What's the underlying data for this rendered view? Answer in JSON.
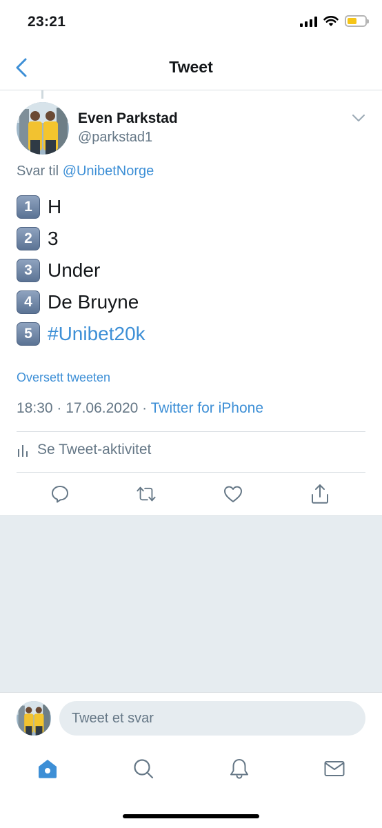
{
  "status_bar": {
    "time": "23:21"
  },
  "nav": {
    "title": "Tweet"
  },
  "tweet": {
    "author_name": "Even Parkstad",
    "author_handle": "@parkstad1",
    "reply_prefix": "Svar til",
    "reply_to": "@UnibetNorge",
    "lines": [
      {
        "key": "1",
        "text": "H"
      },
      {
        "key": "2",
        "text": "3"
      },
      {
        "key": "3",
        "text": "Under"
      },
      {
        "key": "4",
        "text": "De Bruyne"
      },
      {
        "key": "5",
        "text": "#Unibet20k"
      }
    ],
    "translate_label": "Oversett tweeten",
    "timestamp": "18:30 · 17.06.2020 · ",
    "source": "Twitter for iPhone",
    "activity_label": "Se Tweet-aktivitet"
  },
  "reply_bar": {
    "placeholder": "Tweet et svar"
  },
  "colors": {
    "accent": "#3d8fd6",
    "secondary_text": "#657786",
    "background_gray": "#e6ecf0"
  }
}
